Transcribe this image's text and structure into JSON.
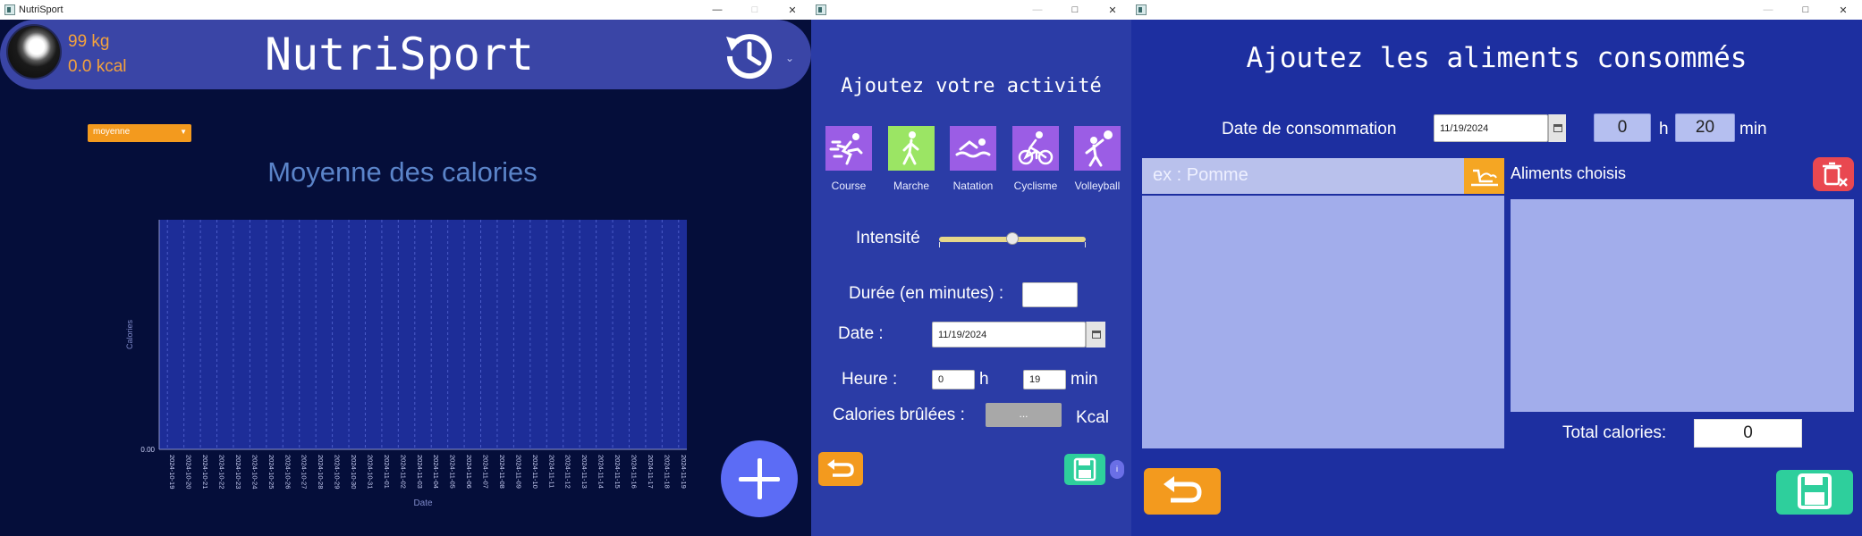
{
  "window1": {
    "title": "NutriSport",
    "header": {
      "weight": "99 kg",
      "calories": "0.0 kcal",
      "app_title": "NutriSport"
    },
    "period_select": "moyenne",
    "chart_title": "Moyenne des calories",
    "chart_data": {
      "type": "bar",
      "title": "Moyenne des calories",
      "xlabel": "Date",
      "ylabel": "Calories",
      "categories": [
        "2024-10-19",
        "2024-10-20",
        "2024-10-21",
        "2024-10-22",
        "2024-10-23",
        "2024-10-24",
        "2024-10-25",
        "2024-10-26",
        "2024-10-27",
        "2024-10-28",
        "2024-10-29",
        "2024-10-30",
        "2024-10-31",
        "2024-11-01",
        "2024-11-02",
        "2024-11-03",
        "2024-11-04",
        "2024-11-05",
        "2024-11-06",
        "2024-11-07",
        "2024-11-08",
        "2024-11-09",
        "2024-11-10",
        "2024-11-11",
        "2024-11-12",
        "2024-11-13",
        "2024-11-14",
        "2024-11-15",
        "2024-11-16",
        "2024-11-17",
        "2024-11-18",
        "2024-11-19"
      ],
      "values": [
        0,
        0,
        0,
        0,
        0,
        0,
        0,
        0,
        0,
        0,
        0,
        0,
        0,
        0,
        0,
        0,
        0,
        0,
        0,
        0,
        0,
        0,
        0,
        0,
        0,
        0,
        0,
        0,
        0,
        0,
        0,
        0
      ],
      "y_tick_labels": [
        "0.00"
      ],
      "grid": true
    }
  },
  "window2": {
    "title": "Ajoutez votre activité",
    "activities": [
      {
        "label": "Course",
        "icon": "running-icon"
      },
      {
        "label": "Marche",
        "icon": "walking-icon"
      },
      {
        "label": "Natation",
        "icon": "swimming-icon"
      },
      {
        "label": "Cyclisme",
        "icon": "cycling-icon"
      },
      {
        "label": "Volleyball",
        "icon": "volleyball-icon"
      }
    ],
    "activity_colors": [
      "#9b5de5",
      "#9be564",
      "#9b5de5",
      "#9b5de5",
      "#9b5de5"
    ],
    "intensity_label": "Intensité",
    "intensity_level": 0.5,
    "duration_label": "Durée (en minutes) :",
    "duration_value": "",
    "date_label": "Date :",
    "date_value": "11/19/2024",
    "time_label": "Heure :",
    "hour_value": "0",
    "hour_unit": "h",
    "minute_value": "19",
    "minute_unit": "min",
    "calories_label": "Calories brûlées :",
    "calories_button": "...",
    "calories_unit": "Kcal",
    "info_label": "i"
  },
  "window3": {
    "title": "Ajoutez les aliments consommés",
    "date_label": "Date de consommation",
    "date_value": "11/19/2024",
    "hour_value": "0",
    "hour_unit": "h",
    "minute_value": "20",
    "minute_unit": "min",
    "search_placeholder": "ex : Pomme",
    "chosen_label": "Aliments choisis",
    "total_label": "Total calories:",
    "total_value": "0"
  }
}
